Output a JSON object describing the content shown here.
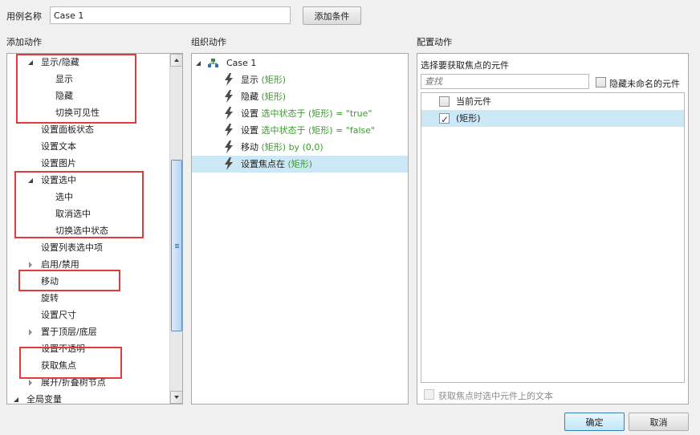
{
  "header": {
    "case_name_label": "用例名称",
    "case_name_value": "Case 1",
    "add_condition_button": "添加条件"
  },
  "add_actions": {
    "title": "添加动作",
    "items": [
      {
        "label": "显示/隐藏",
        "level": 1,
        "expander": "expanded"
      },
      {
        "label": "显示",
        "level": 2
      },
      {
        "label": "隐藏",
        "level": 2
      },
      {
        "label": "切换可见性",
        "level": 2
      },
      {
        "label": "设置面板状态",
        "level": 1
      },
      {
        "label": "设置文本",
        "level": 1
      },
      {
        "label": "设置图片",
        "level": 1
      },
      {
        "label": "设置选中",
        "level": 1,
        "expander": "expanded"
      },
      {
        "label": "选中",
        "level": 2
      },
      {
        "label": "取消选中",
        "level": 2
      },
      {
        "label": "切换选中状态",
        "level": 2
      },
      {
        "label": "设置列表选中项",
        "level": 1
      },
      {
        "label": "启用/禁用",
        "level": 1,
        "expander": "collapsed"
      },
      {
        "label": "移动",
        "level": 1
      },
      {
        "label": "旋转",
        "level": 1
      },
      {
        "label": "设置尺寸",
        "level": 1
      },
      {
        "label": "置于顶层/底层",
        "level": 1,
        "expander": "collapsed"
      },
      {
        "label": "设置不透明",
        "level": 1
      },
      {
        "label": "获取焦点",
        "level": 1
      },
      {
        "label": "展开/折叠树节点",
        "level": 1,
        "expander": "collapsed"
      },
      {
        "label": "全局变量",
        "level": 0,
        "expander": "expanded"
      }
    ]
  },
  "organize_actions": {
    "title": "组织动作",
    "case_label": "Case 1",
    "actions": [
      {
        "verb": "显示",
        "detail": " (矩形)"
      },
      {
        "verb": "隐藏",
        "detail": " (矩形)"
      },
      {
        "verb": "设置",
        "detail": " 选中状态于 (矩形) = \"true\""
      },
      {
        "verb": "设置",
        "detail": " 选中状态于 (矩形) = \"false\""
      },
      {
        "verb": "移动",
        "detail": " (矩形) by (0,0)"
      },
      {
        "verb": "设置焦点在",
        "detail": " (矩形)"
      }
    ]
  },
  "configure_actions": {
    "title": "配置动作",
    "subtitle": "选择要获取焦点的元件",
    "search_placeholder": "查找",
    "hide_unnamed_label": "隐藏未命名的元件",
    "widgets": [
      {
        "label": "当前元件",
        "checked": false
      },
      {
        "label": "(矩形)",
        "checked": true
      }
    ],
    "select_text_label": "获取焦点时选中元件上的文本"
  },
  "footer": {
    "ok_button": "确定",
    "cancel_button": "取消"
  },
  "colors": {
    "highlight_box": "#e33a3a",
    "selection": "#cce8f6",
    "detail_text": "#3c9a2d"
  }
}
